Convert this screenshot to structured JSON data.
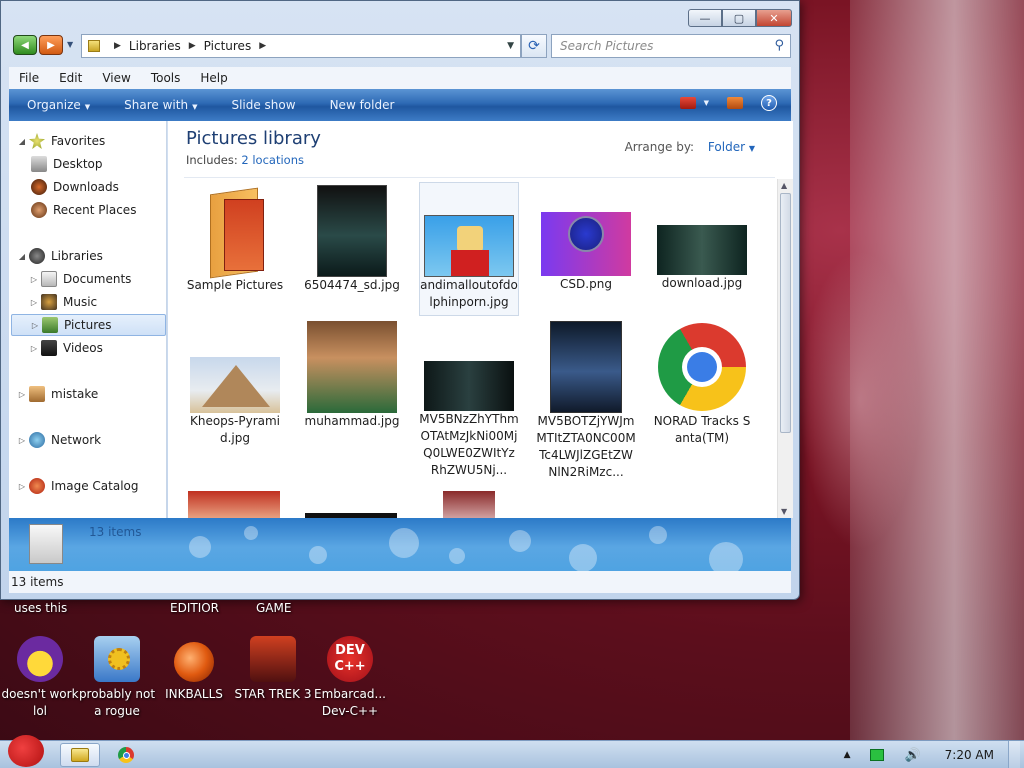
{
  "window": {
    "caption_buttons": {
      "minimize": "—",
      "maximize": "▢",
      "close": "✕"
    },
    "breadcrumb": [
      "Libraries",
      "Pictures"
    ],
    "search_placeholder": "Search Pictures",
    "menu": [
      "File",
      "Edit",
      "View",
      "Tools",
      "Help"
    ],
    "commands": [
      {
        "label": "Organize",
        "dropdown": true
      },
      {
        "label": "Share with",
        "dropdown": true
      },
      {
        "label": "Slide show",
        "dropdown": false
      },
      {
        "label": "New folder",
        "dropdown": false
      }
    ],
    "help_glyph": "?"
  },
  "nav": {
    "favorites": {
      "label": "Favorites",
      "items": [
        "Desktop",
        "Downloads",
        "Recent Places"
      ]
    },
    "libraries": {
      "label": "Libraries",
      "items": [
        "Documents",
        "Music",
        "Pictures",
        "Videos"
      ]
    },
    "others": [
      "mistake",
      "Network",
      "Image Catalog"
    ]
  },
  "content": {
    "title": "Pictures library",
    "includes_label": "Includes:",
    "includes_link": "2 locations",
    "arrange_label": "Arrange by:",
    "arrange_value": "Folder",
    "files": [
      {
        "name": "Sample Pictures",
        "type": "folder"
      },
      {
        "name": "6504474_sd.jpg"
      },
      {
        "name": "andimalloutofdolphinporn.jpg",
        "selected": true
      },
      {
        "name": "CSD.png"
      },
      {
        "name": "download.jpg"
      },
      {
        "name": "Kheops-Pyramid.jpg"
      },
      {
        "name": "muhammad.jpg"
      },
      {
        "name": "MV5BNzZhYThmOTAtMzJkNi00MjQ0LWE0ZWItYzRhZWU5Nj..."
      },
      {
        "name": "MV5BOTZjYWJmMTItZTA0NC00MTc4LWJlZGEtZWNlN2RiMzc..."
      },
      {
        "name": "NORAD Tracks Santa(TM)"
      }
    ]
  },
  "details": {
    "count": "13 items"
  },
  "status": {
    "count": "13 items"
  },
  "desktop": {
    "labels": [
      "uses this",
      "EDITIOR",
      "GAME"
    ],
    "icons": [
      {
        "label": "doesn't work lol",
        "icon": "yahoo-messenger-icon",
        "color": "#6b2aa0"
      },
      {
        "label": "probably not a rogue",
        "icon": "gears-monitor-icon",
        "color": "#3a78c8"
      },
      {
        "label": "INKBALLS",
        "icon": "inkball-icon",
        "color": "#e05a10"
      },
      {
        "label": "STAR TREK 3",
        "icon": "star-wars-icon",
        "color": "#7a1010"
      },
      {
        "label": "Embarcad... Dev-C++",
        "icon": "devcpp-icon",
        "color": "#c8191e"
      }
    ],
    "devcpp_logo": "DEV C++"
  },
  "taskbar": {
    "clock": "7:20 AM",
    "tray_up": "▲",
    "volume_glyph": "🔊"
  }
}
